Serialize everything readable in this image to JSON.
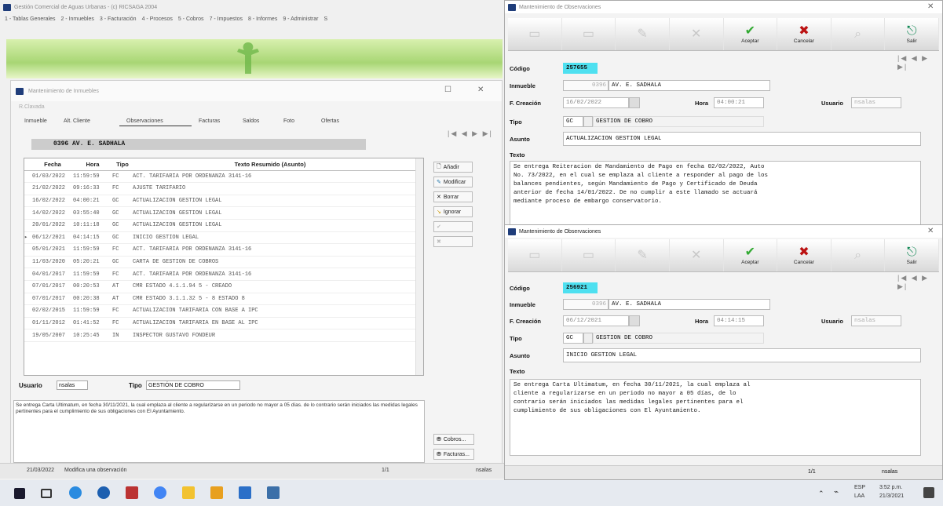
{
  "app": {
    "title": "Gestión Comercial de Aguas Urbanas - (c) RICSAGA 2004",
    "menu": [
      "1 - Tablas Generales",
      "2 - Inmuebles",
      "3 - Facturación",
      "4 - Procesos",
      "5 - Cobros",
      "7 - Impuestos",
      "8 - Informes",
      "9 - Administrar",
      "S"
    ]
  },
  "immwin": {
    "title": "Mantenimiento de Inmuebles",
    "subheader": "R.Clavada",
    "tabs": [
      "Inmueble",
      "Alt. Cliente",
      "Observaciones",
      "Facturas",
      "Saldos",
      "Foto",
      "Ofertas"
    ],
    "nav": "|◀ ◀ ▶ ▶|",
    "address": "0396 AV. E. SADHALA",
    "columns": {
      "fecha": "Fecha",
      "hora": "Hora",
      "tipo": "Tipo",
      "texto": "Texto Resumido (Asunto)"
    },
    "rows": [
      {
        "mark": "",
        "fecha": "01/03/2022",
        "hora": "11:59:59",
        "tipo": "FC",
        "texto": "ACT. TARIFARIA POR ORDENANZA 3141-16"
      },
      {
        "mark": "",
        "fecha": "21/02/2022",
        "hora": "09:16:33",
        "tipo": "FC",
        "texto": "AJUSTE TARIFARIO"
      },
      {
        "mark": "",
        "fecha": "16/02/2022",
        "hora": "04:00:21",
        "tipo": "GC",
        "texto": "ACTUALIZACION GESTION LEGAL"
      },
      {
        "mark": "",
        "fecha": "14/02/2022",
        "hora": "03:55:40",
        "tipo": "GC",
        "texto": "ACTUALIZACION GESTION LEGAL"
      },
      {
        "mark": "",
        "fecha": "20/01/2022",
        "hora": "10:11:18",
        "tipo": "GC",
        "texto": "ACTUALIZACION GESTION LEGAL"
      },
      {
        "mark": "▸",
        "fecha": "06/12/2021",
        "hora": "04:14:15",
        "tipo": "GC",
        "texto": "INICIO GESTION LEGAL"
      },
      {
        "mark": "",
        "fecha": "05/01/2021",
        "hora": "11:59:59",
        "tipo": "FC",
        "texto": "ACT. TARIFARIA POR ORDENANZA 3141-16"
      },
      {
        "mark": "",
        "fecha": "11/03/2020",
        "hora": "05:20:21",
        "tipo": "GC",
        "texto": "CARTA DE GESTION DE COBROS"
      },
      {
        "mark": "",
        "fecha": "04/01/2017",
        "hora": "11:59:59",
        "tipo": "FC",
        "texto": "ACT. TARIFARIA POR ORDENANZA 3141-16"
      },
      {
        "mark": "",
        "fecha": "07/01/2017",
        "hora": "00:20:53",
        "tipo": "AT",
        "texto": "CMR ESTADO 4.1.1.94 5 - CREADO"
      },
      {
        "mark": "",
        "fecha": "07/01/2017",
        "hora": "00:20:38",
        "tipo": "AT",
        "texto": "CMR ESTADO 3.1.1.32 5 - 8 ESTADO 8"
      },
      {
        "mark": "",
        "fecha": "02/02/2015",
        "hora": "11:59:59",
        "tipo": "FC",
        "texto": "ACTUALIZACION TARIFARIA CON BASE A IPC"
      },
      {
        "mark": "",
        "fecha": "01/11/2012",
        "hora": "01:41:52",
        "tipo": "FC",
        "texto": "ACTUALIZACION TARIFARIA EN BASE AL IPC"
      },
      {
        "mark": "",
        "fecha": "19/05/2007",
        "hora": "10:25:45",
        "tipo": "IN",
        "texto": "INSPECTOR GUSTAVO FONDEUR"
      }
    ],
    "buttons": {
      "anadir": "Añadir",
      "modificar": "Modificar",
      "borrar": "Borrar",
      "ignorar": "Ignorar",
      "cobros": "Cobros...",
      "facturas": "Facturas..."
    },
    "usuario_label": "Usuario",
    "usuario_value": "nsalas",
    "tipo_label": "Tipo",
    "tipo_value": "GESTIÓN DE COBRO",
    "memo": "Se entrega Carta Ultimatum, en fecha 30/11/2021, la cual emplaza al cliente a regularizarse en un periodo no mayor a 05 días. de lo contrario serán iniciados las medidas legales pertinentes para el cumplimiento de sus obligaciones con El Ayuntamiento.",
    "status": {
      "date": "21/03/2022",
      "msg": "Modifica una observación",
      "pages": "1/1",
      "user": "nsalas"
    }
  },
  "obs1": {
    "title": "Mantenimiento de Observaciones",
    "toolbar": [
      "",
      "",
      "",
      "",
      "Aceptar",
      "Cancelar",
      "",
      "Salir"
    ],
    "codigo_label": "Código",
    "codigo": "257655",
    "inmueble_label": "Inmueble",
    "inmueble_num": "0396",
    "inmueble_addr": "AV. E. SADHALA",
    "fcreacion_label": "F. Creación",
    "fcreacion": "16/02/2022",
    "hora_label": "Hora",
    "hora": "04:00:21",
    "usuario_label": "Usuario",
    "usuario": "nsalas",
    "tipo_label": "Tipo",
    "tipo_code": "GC",
    "tipo_desc": "GESTION DE COBRO",
    "asunto_label": "Asunto",
    "asunto": "ACTUALIZACION GESTION LEGAL",
    "texto_label": "Texto",
    "texto": "Se entrega Reiteracion de Mandamiento de Pago en fecha 02/02/2022, Auto\nNo. 73/2022, en el cual se emplaza al cliente a responder al pago de los\nbalances pendientes, según Mandamiento de Pago y Certificado de Deuda\nanterior de fecha 14/01/2022. De no cumplir a este llamado se actuará\nmediante proceso de embargo conservatorio."
  },
  "obs2": {
    "title": "Mantenimiento de Observaciones",
    "toolbar": [
      "",
      "",
      "",
      "",
      "Aceptar",
      "Cancelar",
      "",
      "Salir"
    ],
    "codigo_label": "Código",
    "codigo": "256921",
    "inmueble_label": "Inmueble",
    "inmueble_num": "0396",
    "inmueble_addr": "AV. E. SADHALA",
    "fcreacion_label": "F. Creación",
    "fcreacion": "06/12/2021",
    "hora_label": "Hora",
    "hora": "04:14:15",
    "usuario_label": "Usuario",
    "usuario": "nsalas",
    "tipo_label": "Tipo",
    "tipo_code": "GC",
    "tipo_desc": "GESTION DE COBRO",
    "asunto_label": "Asunto",
    "asunto": "INICIO GESTION LEGAL",
    "texto_label": "Texto",
    "texto": "Se entrega Carta Ultimatum, en fecha 30/11/2021, la cual emplaza al\ncliente a regularizarse en un periodo no mayor a 05 días, de lo\ncontrario serán iniciados las medidas legales pertinentes para el\ncumplimiento de sus obligaciones con El Ayuntamiento.",
    "status": {
      "pages": "1/1",
      "user": "nsalas"
    }
  },
  "taskbar": {
    "lang": "ESP",
    "lang2": "LAA",
    "time": "3:52 p.m.",
    "date": "21/3/2021"
  },
  "colors": {
    "accent_cyan": "#4ee0f0",
    "banner_green": "#a8d674",
    "grid_selected": "#ffffff"
  }
}
